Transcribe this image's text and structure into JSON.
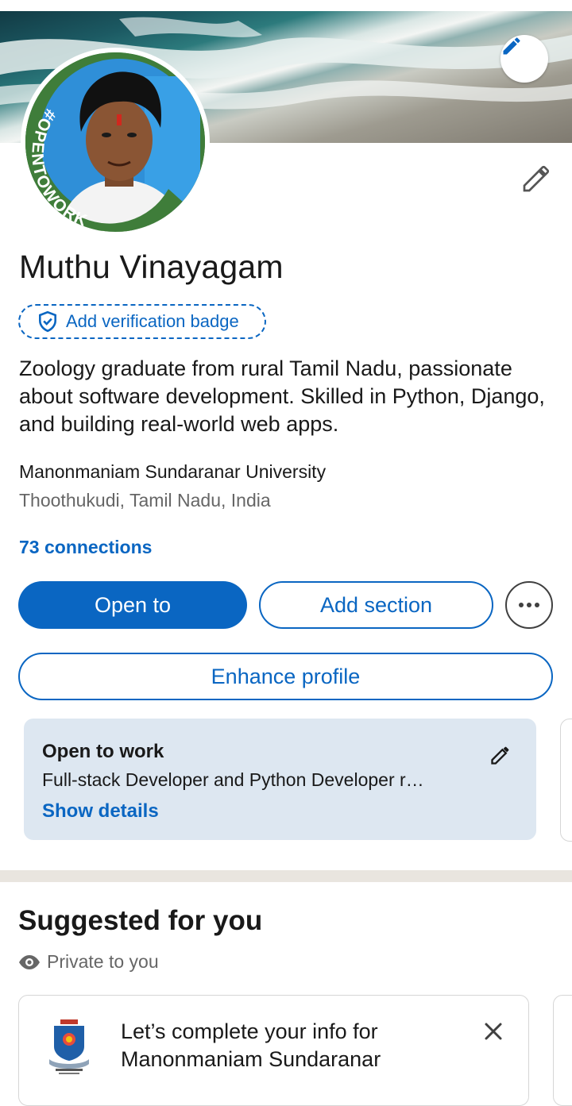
{
  "profile": {
    "name": "Muthu Vinayagam",
    "frame_text": "#OPENTOWORK",
    "verification_badge_label": "Add verification badge",
    "headline": "Zoology graduate from rural Tamil Nadu, passionate about software development. Skilled in Python, Django, and building real-world web apps.",
    "education": "Manonmaniam Sundaranar University",
    "location": "Thoothukudi, Tamil Nadu, India",
    "connections": "73 connections"
  },
  "actions": {
    "open_to": "Open to",
    "add_section": "Add section",
    "enhance_profile": "Enhance profile"
  },
  "open_to_work": {
    "title": "Open to work",
    "description": "Full-stack Developer and Python Developer r…",
    "link": "Show details"
  },
  "suggested": {
    "title": "Suggested for you",
    "privacy": "Private to you",
    "card_text": "Let’s complete your info for Manonmaniam Sundaranar"
  },
  "colors": {
    "accent": "#0a66c2",
    "open_to_work_green": "#3f7d3a",
    "card_bg": "#dde7f1"
  }
}
